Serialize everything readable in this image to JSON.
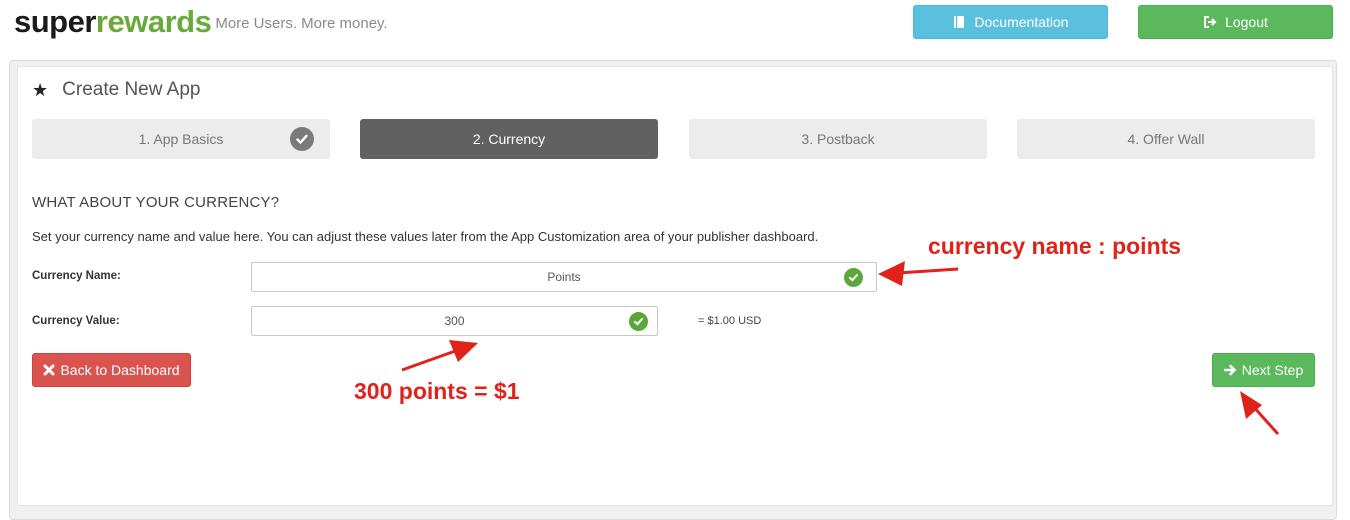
{
  "header": {
    "logo_part1": "super",
    "logo_part2": "rewards",
    "tagline": "More Users. More money.",
    "documentation_label": "Documentation",
    "logout_label": "Logout"
  },
  "panel": {
    "title": "Create New App",
    "star_icon": "★"
  },
  "steps": [
    {
      "label": "1. App Basics",
      "completed": true
    },
    {
      "label": "2. Currency",
      "active": true
    },
    {
      "label": "3. Postback"
    },
    {
      "label": "4. Offer Wall"
    }
  ],
  "form": {
    "section_title": "WHAT ABOUT YOUR CURRENCY?",
    "description": "Set your currency name and value here. You can adjust these values later from the App Customization area of your publisher dashboard.",
    "currency_name_label": "Currency Name:",
    "currency_name_value": "Points",
    "currency_value_label": "Currency Value:",
    "currency_value_value": "300",
    "usd_equivalent": "= $1.00 USD"
  },
  "actions": {
    "back_label": "Back to Dashboard",
    "next_label": "Next Step"
  },
  "annotations": {
    "currency_name": "currency name : points",
    "points_value": "300 points = $1",
    "color": "#e0231a"
  },
  "colors": {
    "info": "#5bc0de",
    "success": "#5cb85c",
    "danger": "#d9534f",
    "step_active": "#616161",
    "brand_green": "#6aaa3a"
  }
}
